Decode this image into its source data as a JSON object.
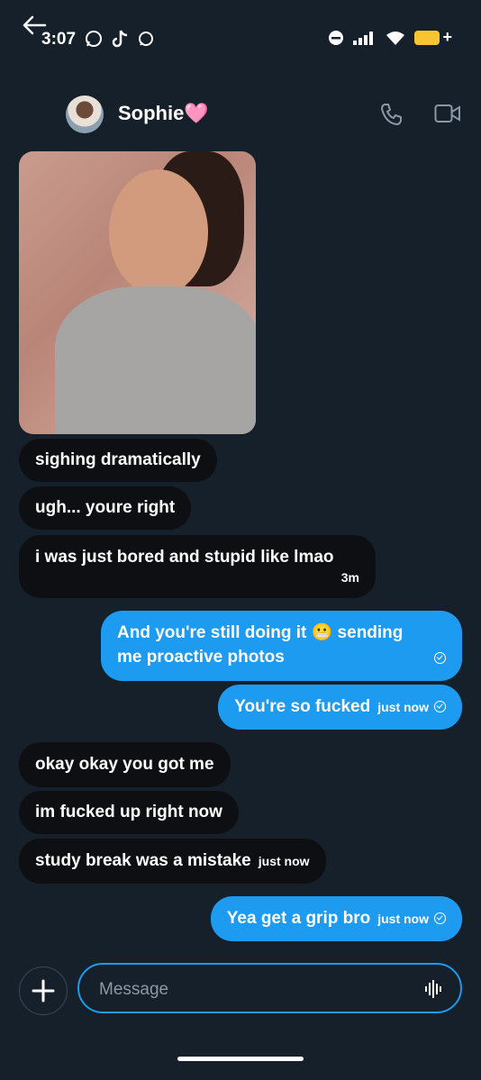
{
  "status": {
    "time": "3:07"
  },
  "contact": {
    "name": "Sophie🩷"
  },
  "messages": [
    {
      "text": "sighing dramatically",
      "meta": ""
    },
    {
      "text": "ugh... youre right",
      "meta": ""
    },
    {
      "text": "i was just bored and stupid like lmao",
      "meta": "3m"
    },
    {
      "text_line1": "And you're still doing it 😬 sending",
      "text_line2": "me proactive photos"
    },
    {
      "text": "You're so fucked",
      "meta": "just now"
    },
    {
      "text": "okay okay you got me"
    },
    {
      "text": "im fucked up right now"
    },
    {
      "text": "study break was a mistake",
      "meta": "just now"
    },
    {
      "text": "Yea get a grip bro",
      "meta": "just now"
    }
  ],
  "composer": {
    "placeholder": "Message"
  },
  "colors": {
    "accent": "#1d9bf0",
    "background": "#15202b",
    "incoming_bubble": "#0d0f12"
  }
}
